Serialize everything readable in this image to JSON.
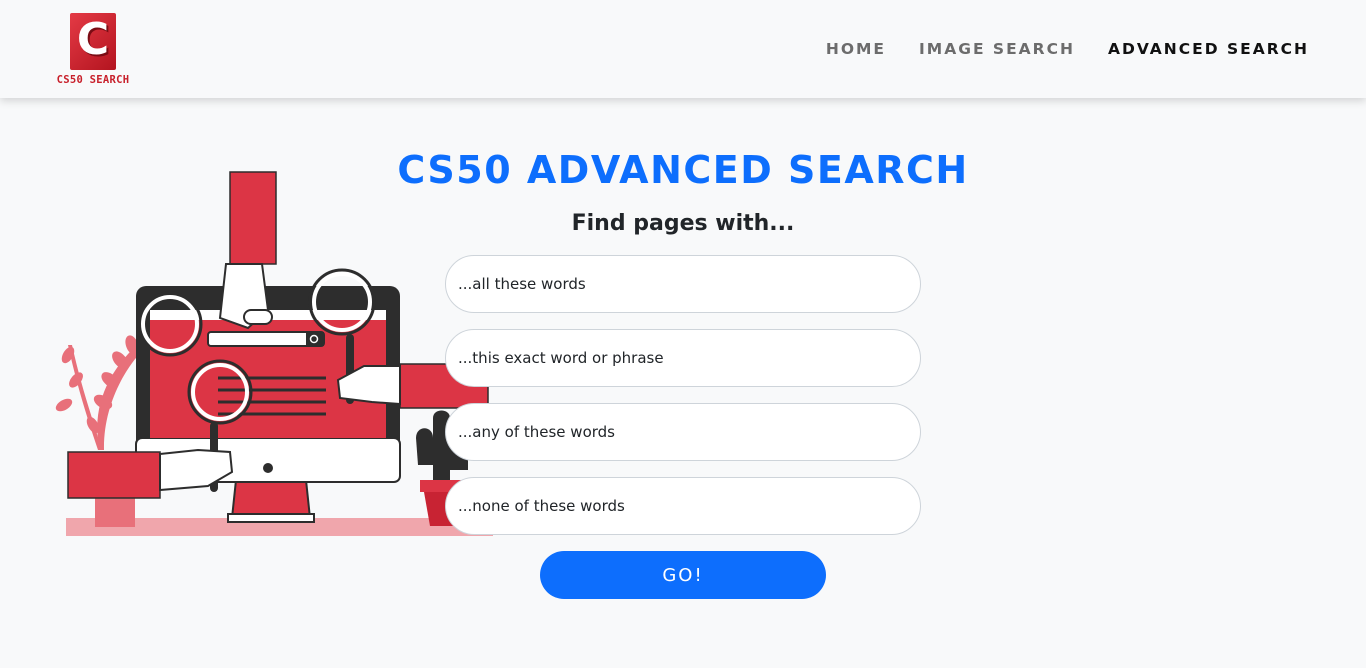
{
  "brand": {
    "logo_letter": "C",
    "name": "CS50 SEARCH"
  },
  "nav": {
    "items": [
      {
        "label": "HOME"
      },
      {
        "label": "IMAGE SEARCH"
      },
      {
        "label": "ADVANCED SEARCH",
        "active": true
      }
    ]
  },
  "main": {
    "title": "CS50 ADVANCED SEARCH",
    "subtitle": "Find pages with...",
    "fields": [
      {
        "placeholder": "...all these words",
        "value": ""
      },
      {
        "placeholder": "...this exact word or phrase",
        "value": ""
      },
      {
        "placeholder": "...any of these words",
        "value": ""
      },
      {
        "placeholder": "...none of these words",
        "value": ""
      }
    ],
    "submit_label": "GO!"
  },
  "colors": {
    "accent": "#0d6efd",
    "brand_red": "#dc3545",
    "background": "#f8f9fa"
  },
  "icons": [
    "search-illustration",
    "magnifier-icon"
  ]
}
